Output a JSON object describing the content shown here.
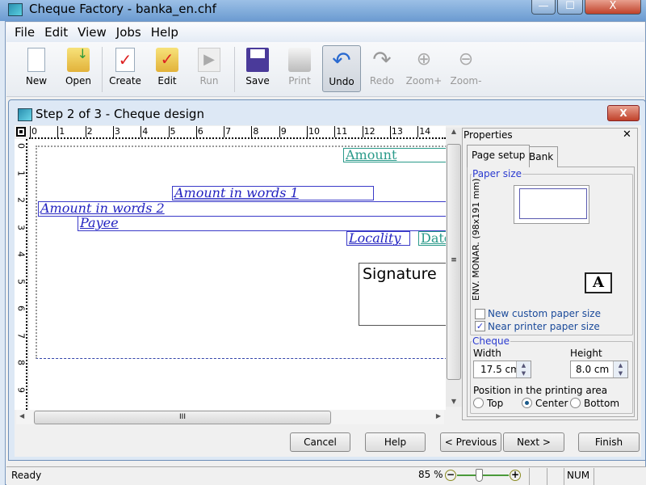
{
  "window": {
    "title": "Cheque Factory - banka_en.chf",
    "minimize": "—",
    "maximize": "☐",
    "close": "X"
  },
  "menu": [
    "File",
    "Edit",
    "View",
    "Jobs",
    "Help"
  ],
  "toolbar": [
    {
      "label": "New",
      "icon": "new-document-icon",
      "enabled": true
    },
    {
      "label": "Open",
      "icon": "open-folder-icon",
      "enabled": true
    },
    {
      "label": "Create",
      "icon": "create-cheque-icon",
      "enabled": true
    },
    {
      "label": "Edit",
      "icon": "edit-cheque-icon",
      "enabled": true
    },
    {
      "label": "Run",
      "icon": "run-icon",
      "enabled": false
    },
    {
      "label": "Save",
      "icon": "save-floppy-icon",
      "enabled": true
    },
    {
      "label": "Print",
      "icon": "printer-icon",
      "enabled": false
    },
    {
      "label": "Undo",
      "icon": "undo-arrow-icon",
      "enabled": true,
      "pressed": true
    },
    {
      "label": "Redo",
      "icon": "redo-arrow-icon",
      "enabled": false
    },
    {
      "label": "Zoom+",
      "icon": "zoom-in-icon",
      "enabled": false
    },
    {
      "label": "Zoom-",
      "icon": "zoom-out-icon",
      "enabled": false
    }
  ],
  "dialog": {
    "title": "Step 2 of 3 - Cheque design",
    "close": "X"
  },
  "ruler": {
    "top": [
      "0",
      "1",
      "2",
      "3",
      "4",
      "5",
      "6",
      "7",
      "8",
      "9",
      "10",
      "11",
      "12",
      "13",
      "14"
    ],
    "left": [
      "0",
      "1",
      "2",
      "3",
      "4",
      "5",
      "6",
      "7",
      "8",
      "9"
    ]
  },
  "fields": {
    "amount": "Amount",
    "words1": "Amount in words 1",
    "words2": "Amount in words 2",
    "payee": "Payee",
    "locality": "Locality",
    "date": "Date",
    "signature": "Signature"
  },
  "properties": {
    "title": "Properties",
    "close": "✕",
    "tabs": [
      "Page setup",
      "Bank"
    ],
    "paper_size": {
      "label": "Paper size",
      "name": "ENV. MONAR. (98x191 mm)",
      "new_custom": "New custom paper size",
      "new_custom_checked": false,
      "near_printer": "Near printer paper size",
      "near_printer_checked": true
    },
    "cheque": {
      "label": "Cheque",
      "width_label": "Width",
      "width": "17.5 cm",
      "height_label": "Height",
      "height": "8.0 cm",
      "position_label": "Position in the printing area",
      "positions": [
        "Top",
        "Center",
        "Bottom"
      ],
      "selected": "Center"
    }
  },
  "buttons": {
    "cancel": "Cancel",
    "help": "Help",
    "previous": "< Previous",
    "next": "Next >",
    "finish": "Finish"
  },
  "status": {
    "text": "Ready",
    "zoom": "85 %",
    "zoom_percent": 85,
    "num": "NUM"
  }
}
